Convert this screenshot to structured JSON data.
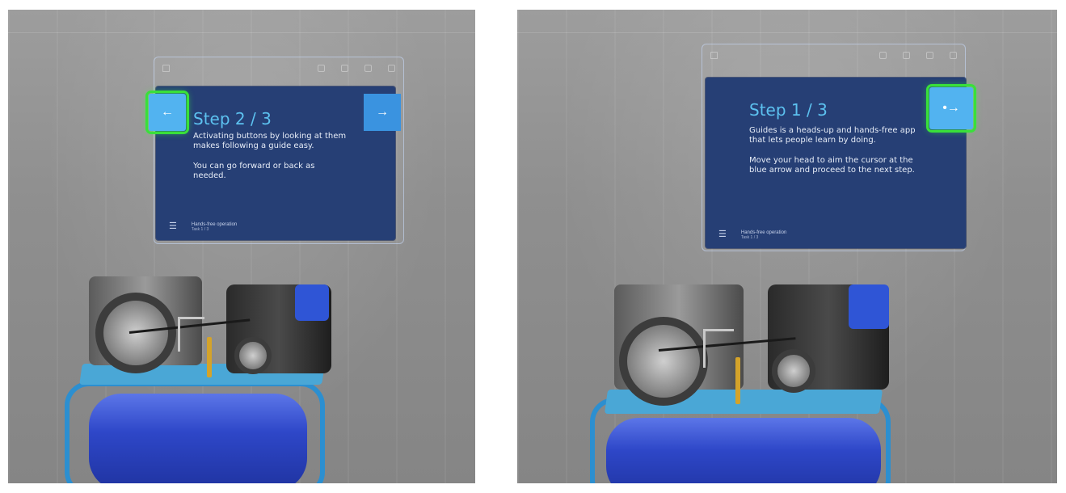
{
  "panels": [
    {
      "id": "left",
      "step_title": "Step 2 / 3",
      "body": [
        "Activating buttons by looking at them makes following a guide easy.",
        "You can go forward or back as needed."
      ],
      "footer_title": "Hands-free operation",
      "footer_task": "Task 1 / 3",
      "back_arrow": "←",
      "next_arrow": "→"
    },
    {
      "id": "right",
      "step_title": "Step 1 / 3",
      "body": [
        "Guides is a heads-up and hands-free app that lets people learn by doing.",
        "Move your head to aim the cursor at the blue arrow and proceed to the next step."
      ],
      "footer_title": "Hands-free operation",
      "footer_task": "Task 1 / 3",
      "next_arrow": "•→"
    }
  ],
  "icons": {
    "list": "☰",
    "home": "home-icon"
  },
  "colors": {
    "card_bg": "#263f75",
    "title": "#5cc1ef",
    "button": "#3a93e0",
    "gaze_highlight": "#39e03a",
    "tank": "#2e47c8"
  }
}
